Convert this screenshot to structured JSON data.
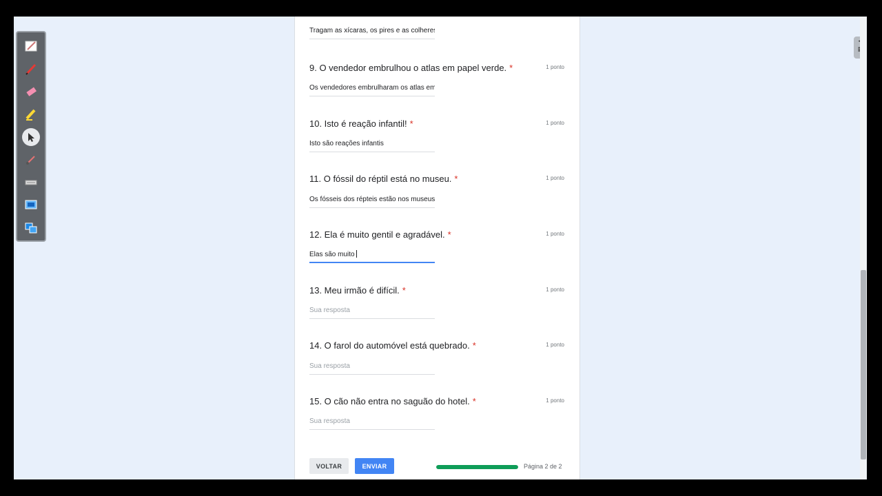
{
  "form": {
    "partial_answer": "Tragam as xícaras, os pires e as colheres",
    "questions": [
      {
        "number_title": "9. O vendedor embrulhou o atlas em papel verde.",
        "required": "*",
        "points": "1 ponto",
        "answer": "Os vendedores embrulharam os atlas em"
      },
      {
        "number_title": "10. Isto é reação infantil!",
        "required": "*",
        "points": "1 ponto",
        "answer": "Isto são reações infantis"
      },
      {
        "number_title": "11. O fóssil do réptil está no museu.",
        "required": "*",
        "points": "1 ponto",
        "answer": "Os fósseis dos répteis estão nos museus"
      },
      {
        "number_title": "12. Ela é muito gentil e agradável.",
        "required": "*",
        "points": "1 ponto",
        "answer": "Elas são muito"
      },
      {
        "number_title": "13. Meu irmão é difícil.",
        "required": "*",
        "points": "1 ponto",
        "placeholder": "Sua resposta"
      },
      {
        "number_title": "14. O farol do automóvel está quebrado.",
        "required": "*",
        "points": "1 ponto",
        "placeholder": "Sua resposta"
      },
      {
        "number_title": "15. O cão não entra no saguão do hotel.",
        "required": "*",
        "points": "1 ponto",
        "placeholder": "Sua resposta"
      }
    ],
    "back_label": "VOLTAR",
    "send_label": "ENVIAR",
    "progress_fraction": 1.0,
    "page_indicator": "Página 2 de 2"
  },
  "colors": {
    "accent": "#4285f4",
    "progress": "#0f9d58",
    "required": "#d93025",
    "page_background": "#e8f0fb"
  },
  "toolbar": {
    "tools": [
      "pen-edit-icon",
      "pen-red-icon",
      "eraser-icon",
      "highlighter-icon",
      "pointer-icon",
      "brush-icon",
      "keyboard-icon",
      "screen-capture-icon",
      "screen-switch-icon"
    ]
  }
}
